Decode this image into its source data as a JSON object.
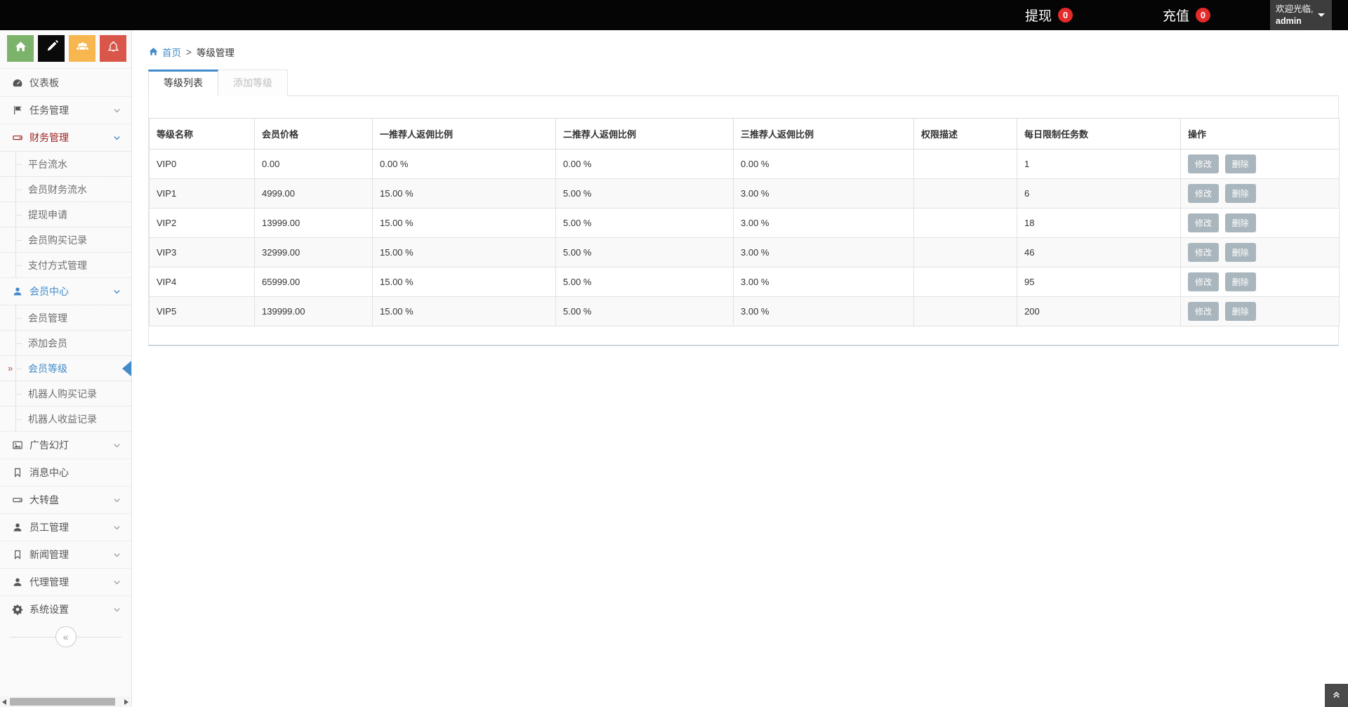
{
  "topbar": {
    "stats": [
      {
        "id": "withdraw",
        "label": "提现",
        "badge": "0"
      },
      {
        "id": "recharge",
        "label": "充值",
        "badge": "0"
      }
    ],
    "user": {
      "line1": "欢迎光临,",
      "line2": "admin"
    }
  },
  "sidebar": {
    "tiles": [
      {
        "icon": "home-icon",
        "color": "#7cb36b"
      },
      {
        "icon": "pencil-icon",
        "color": "#0a0a0a"
      },
      {
        "icon": "users-icon",
        "color": "#f7b64e"
      },
      {
        "icon": "bell-icon",
        "color": "#d9574a"
      }
    ],
    "menu": [
      {
        "label": "仪表板",
        "icon": "gauge-icon"
      },
      {
        "label": "任务管理",
        "icon": "flag-icon",
        "chevron": true
      },
      {
        "label": "财务管理",
        "icon": "hdd-icon",
        "chevron": true,
        "expanded": true,
        "color": "#9c2121",
        "children": [
          "平台流水",
          "会员财务流水",
          "提现申请",
          "会员购买记录",
          "支付方式管理"
        ]
      },
      {
        "label": "会员中心",
        "icon": "user-icon",
        "chevron": true,
        "expanded": true,
        "color": "#428bca",
        "children": [
          "会员管理",
          "添加会员",
          "会员等级",
          "机器人购买记录",
          "机器人收益记录"
        ],
        "active_child": "会员等级"
      },
      {
        "label": "广告幻灯",
        "icon": "image-icon",
        "chevron": true
      },
      {
        "label": "消息中心",
        "icon": "bookmark-icon"
      },
      {
        "label": "大转盘",
        "icon": "hdd-icon",
        "chevron": true
      },
      {
        "label": "员工管理",
        "icon": "user-icon",
        "chevron": true
      },
      {
        "label": "新闻管理",
        "icon": "bookmark-icon",
        "chevron": true
      },
      {
        "label": "代理管理",
        "icon": "user-icon",
        "chevron": true
      },
      {
        "label": "系统设置",
        "icon": "gear-icon",
        "chevron": true
      }
    ],
    "collapse_glyph": "«"
  },
  "breadcrumb": {
    "home_label": "首页",
    "separator": ">",
    "current": "等级管理"
  },
  "tabs": [
    {
      "label": "等级列表",
      "active": true
    },
    {
      "label": "添加等级",
      "active": false
    }
  ],
  "table": {
    "columns": [
      "等级名称",
      "会员价格",
      "一推荐人返佣比例",
      "二推荐人返佣比例",
      "三推荐人返佣比例",
      "权限描述",
      "每日限制任务数",
      "操作"
    ],
    "rows": [
      {
        "name": "VIP0",
        "price": "0.00",
        "level1": "0.00 %",
        "level2": "0.00 %",
        "level3": "0.00 %",
        "permission": "",
        "daily_limit": "1"
      },
      {
        "name": "VIP1",
        "price": "4999.00",
        "level1": "15.00 %",
        "level2": "5.00 %",
        "level3": "3.00 %",
        "permission": "",
        "daily_limit": "6"
      },
      {
        "name": "VIP2",
        "price": "13999.00",
        "level1": "15.00 %",
        "level2": "5.00 %",
        "level3": "3.00 %",
        "permission": "",
        "daily_limit": "18"
      },
      {
        "name": "VIP3",
        "price": "32999.00",
        "level1": "15.00 %",
        "level2": "5.00 %",
        "level3": "3.00 %",
        "permission": "",
        "daily_limit": "46"
      },
      {
        "name": "VIP4",
        "price": "65999.00",
        "level1": "15.00 %",
        "level2": "5.00 %",
        "level3": "3.00 %",
        "permission": "",
        "daily_limit": "95"
      },
      {
        "name": "VIP5",
        "price": "139999.00",
        "level1": "15.00 %",
        "level2": "5.00 %",
        "level3": "3.00 %",
        "permission": "",
        "daily_limit": "200"
      }
    ],
    "actions": {
      "edit": "修改",
      "delete": "删除"
    }
  },
  "colors": {
    "accent": "#428bca",
    "badge_red": "#e52a2a",
    "finance_red": "#9c2121",
    "action_button_gray": "#a9b6bd"
  }
}
